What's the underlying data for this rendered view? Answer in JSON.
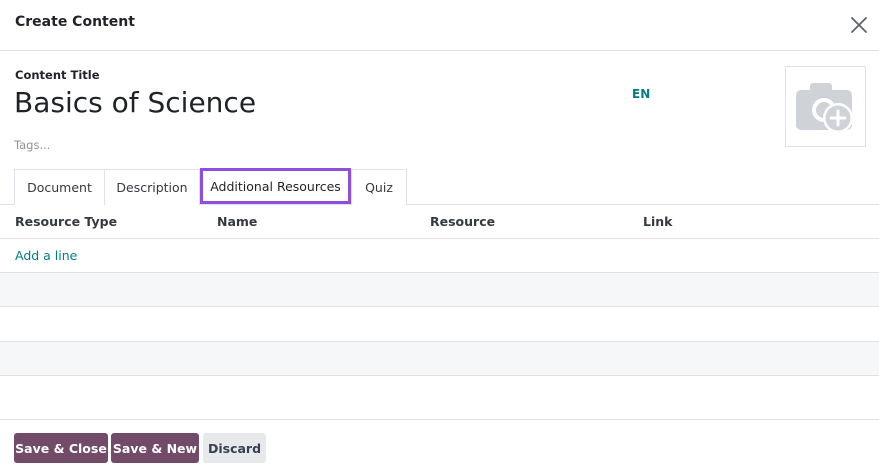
{
  "modal": {
    "title": "Create Content"
  },
  "form": {
    "title_label": "Content Title",
    "title_value": "Basics of Science",
    "lang": "EN",
    "tags_placeholder": "Tags..."
  },
  "tabs": [
    {
      "label": "Document"
    },
    {
      "label": "Description"
    },
    {
      "label": "Additional Resources",
      "active": true
    },
    {
      "label": "Quiz"
    }
  ],
  "table": {
    "columns": [
      "Resource Type",
      "Name",
      "Resource",
      "Link"
    ],
    "add_line": "Add a line"
  },
  "footer": {
    "save_close": "Save & Close",
    "save_new": "Save & New",
    "discard": "Discard"
  },
  "colors": {
    "primary": "#714b67",
    "link": "#017e84",
    "tab_highlight": "#8e4fe0"
  },
  "icons": {
    "close": "close-icon",
    "image_placeholder": "camera-plus-icon"
  }
}
